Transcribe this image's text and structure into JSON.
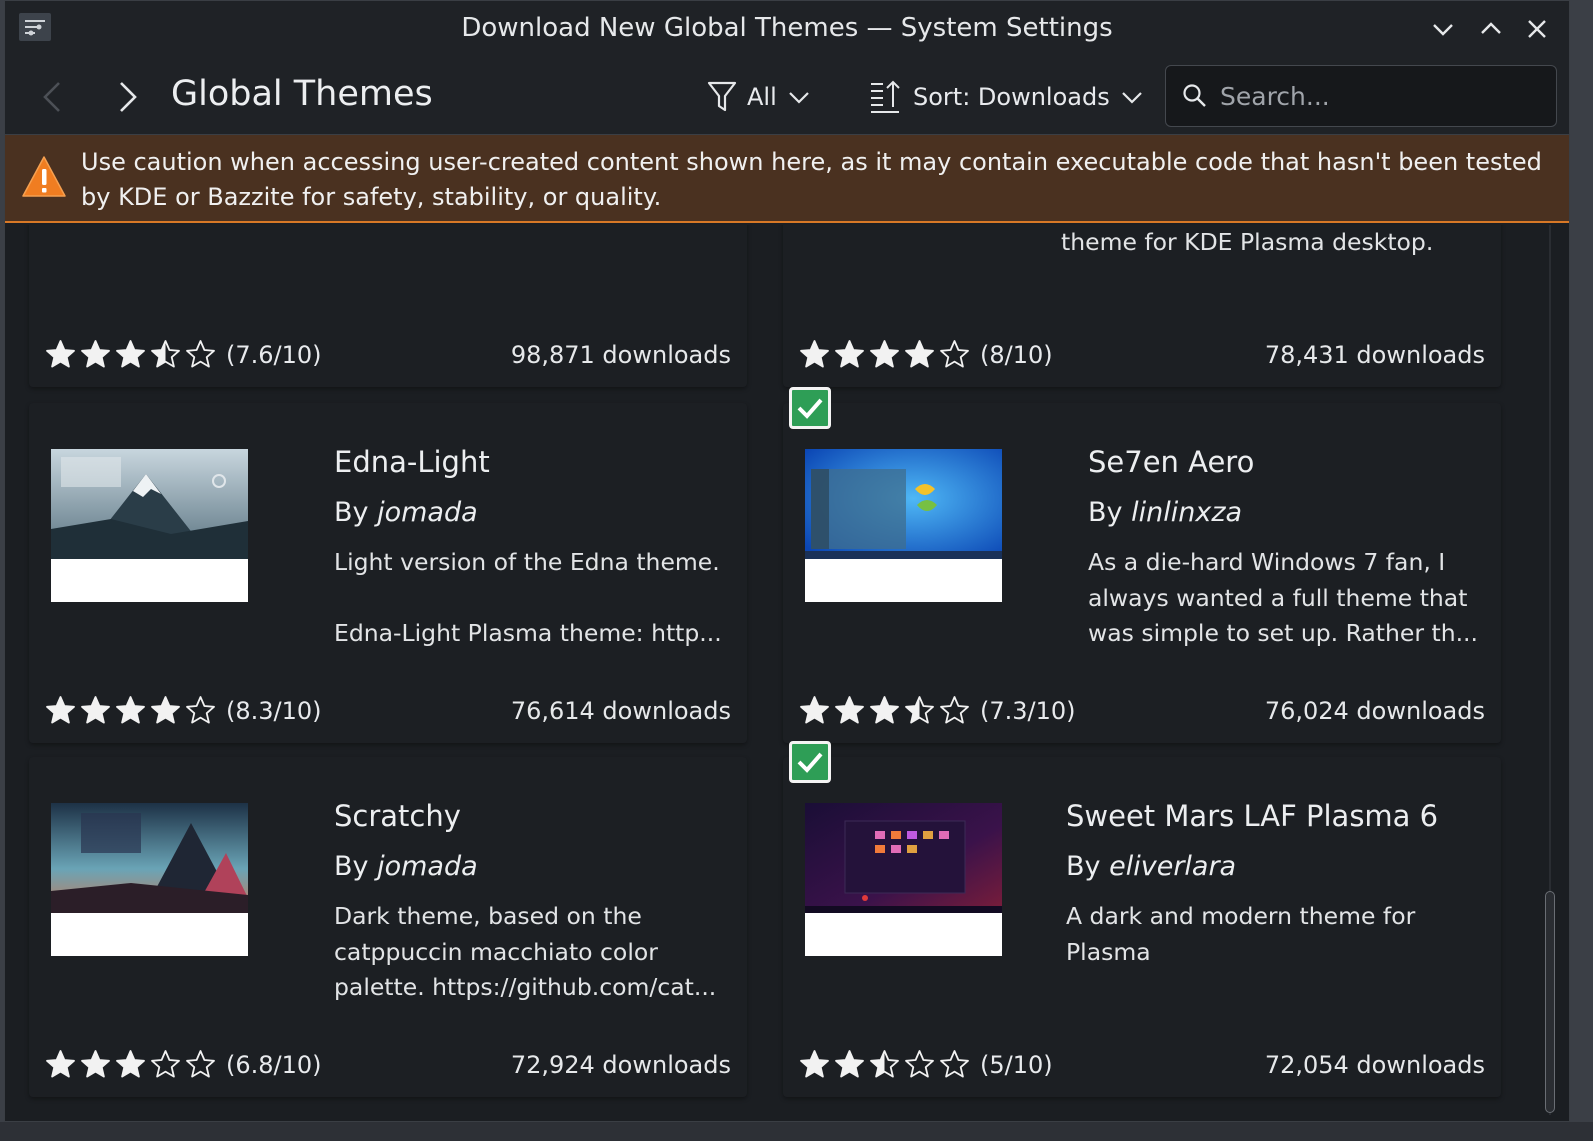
{
  "window": {
    "title": "Download New Global Themes — System Settings"
  },
  "toolbar": {
    "page_title": "Global Themes",
    "filter_label": "All",
    "sort_label": "Sort: Downloads",
    "search_placeholder": "Search..."
  },
  "banner": {
    "text": "Use caution when accessing user-created content shown here, as it may contain executable code that hasn't been tested by KDE or Bazzite for safety, stability, or quality."
  },
  "cards": [
    {
      "name": "",
      "author": "",
      "desc1": "",
      "desc2": "",
      "rating": "(7.6/10)",
      "stars": 3.5,
      "downloads": "98,871 downloads",
      "installed": false
    },
    {
      "name": "",
      "author": "",
      "desc1": "theme for KDE Plasma desktop.",
      "desc2": "",
      "rating": "(8/10)",
      "stars": 4,
      "downloads": "78,431 downloads",
      "installed": false
    },
    {
      "name": "Edna-Light",
      "author": "jomada",
      "desc1": "Light version of the Edna theme.",
      "desc2": "Edna-Light Plasma theme: http...",
      "rating": "(8.3/10)",
      "stars": 4,
      "downloads": "76,614 downloads",
      "installed": false
    },
    {
      "name": "Se7en Aero",
      "author": "linlinxza",
      "desc1": "As a die-hard Windows 7 fan, I always wanted a full theme that was simple to set up. Rather th...",
      "desc2": "",
      "rating": "(7.3/10)",
      "stars": 3.5,
      "downloads": "76,024 downloads",
      "installed": true
    },
    {
      "name": "Scratchy",
      "author": "jomada",
      "desc1": "Dark theme, based on the catppuccin macchiato color palette. https://github.com/cat...",
      "desc2": "",
      "rating": "(6.8/10)",
      "stars": 3,
      "downloads": "72,924 downloads",
      "installed": false
    },
    {
      "name": "Sweet Mars LAF Plasma 6",
      "author": "eliverlara",
      "desc1": "A dark and modern theme for Plasma",
      "desc2": "",
      "rating": "(5/10)",
      "stars": 2.5,
      "downloads": "72,054 downloads",
      "installed": true
    }
  ],
  "by_prefix": "By",
  "colors": {
    "accent_warning": "#d87826",
    "installed_check": "#2e9e56",
    "banner_bg": "#4a3120"
  }
}
